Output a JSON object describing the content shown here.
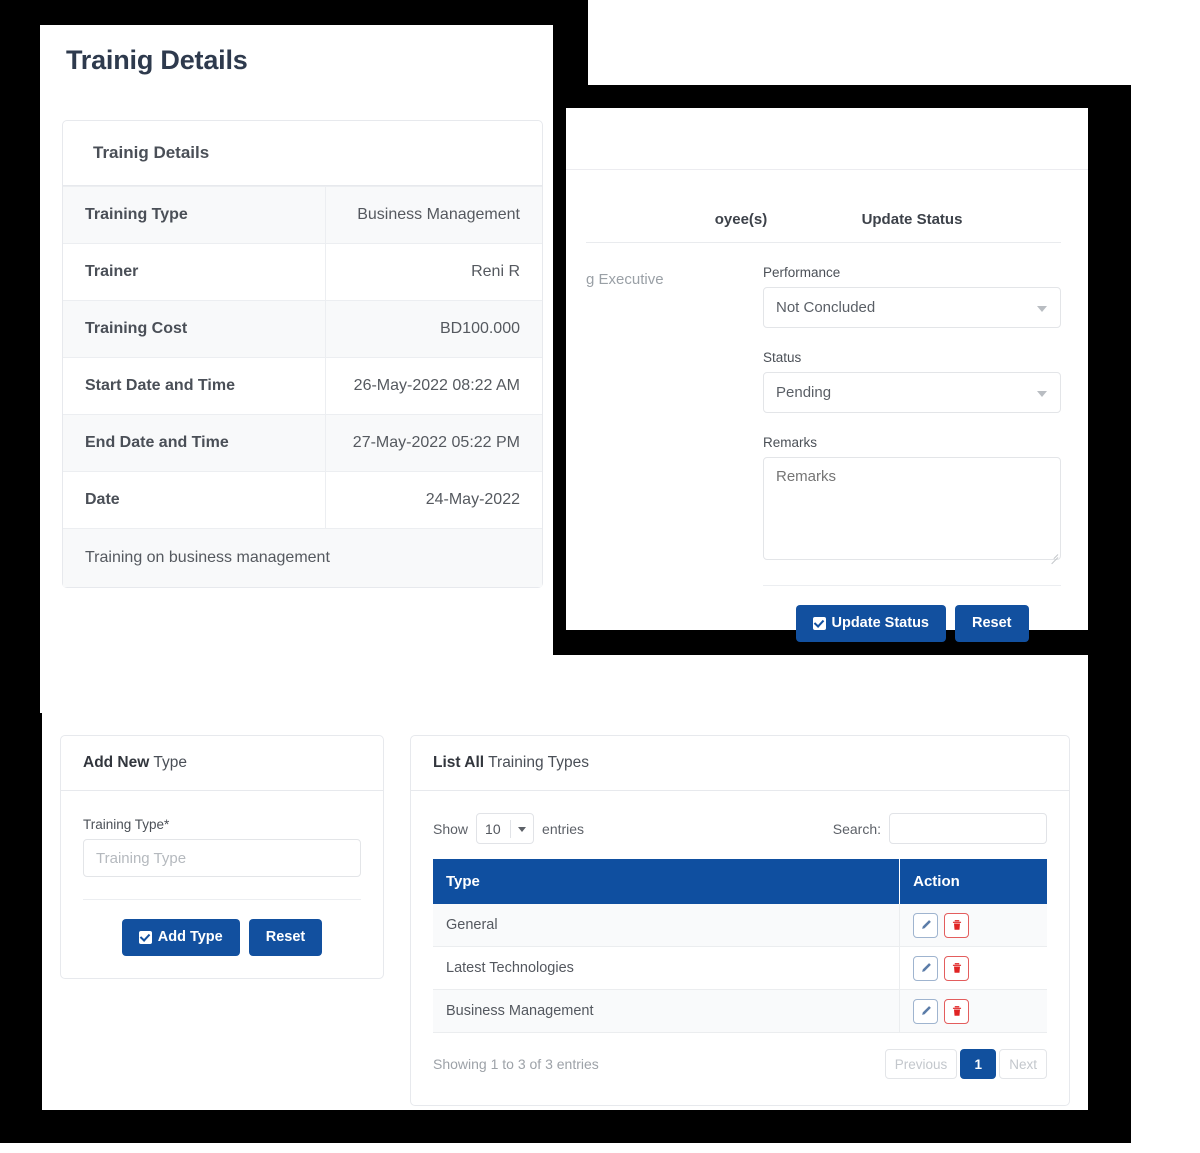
{
  "theme": {
    "primary": "#12509f",
    "table_header": "#0f4fa0",
    "backdrop": "#000000",
    "danger": "#e35d5d"
  },
  "details_page": {
    "page_title": "Trainig Details",
    "card_title": "Trainig Details",
    "rows": [
      {
        "label": "Training Type",
        "value": "Business Management"
      },
      {
        "label": "Trainer",
        "value": "Reni R"
      },
      {
        "label": "Training Cost",
        "value": "BD100.000"
      },
      {
        "label": "Start Date and Time",
        "value": "26-May-2022 08:22 AM"
      },
      {
        "label": "End Date and Time",
        "value": "27-May-2022 05:22 PM"
      },
      {
        "label": "Date",
        "value": "24-May-2022"
      }
    ],
    "description": "Training on business management"
  },
  "status_page": {
    "employee_column": {
      "title": "oyee(s)",
      "subtitle": "g Executive"
    },
    "update_column": {
      "title": "Update Status",
      "performance_label": "Performance",
      "performance_value": "Not Concluded",
      "status_label": "Status",
      "status_value": "Pending",
      "remarks_label": "Remarks",
      "remarks_placeholder": "Remarks",
      "remarks_value": "",
      "submit_label": "Update Status",
      "reset_label": "Reset"
    }
  },
  "types_page": {
    "add_card": {
      "title_strong": "Add New",
      "title_rest": " Type",
      "field_label": "Training Type*",
      "field_placeholder": "Training Type",
      "field_value": "",
      "submit_label": "Add Type",
      "reset_label": "Reset"
    },
    "list_card": {
      "title_strong": "List All",
      "title_rest": " Training Types",
      "show_label": "Show",
      "page_length": "10",
      "entries_label": "entries",
      "search_label": "Search:",
      "search_value": "",
      "columns": [
        "Type",
        "Action"
      ],
      "rows": [
        {
          "type": "General"
        },
        {
          "type": "Latest Technologies"
        },
        {
          "type": "Business Management"
        }
      ],
      "info": "Showing 1 to 3 of 3 entries",
      "pagination": {
        "previous": "Previous",
        "current": "1",
        "next": "Next"
      }
    }
  }
}
